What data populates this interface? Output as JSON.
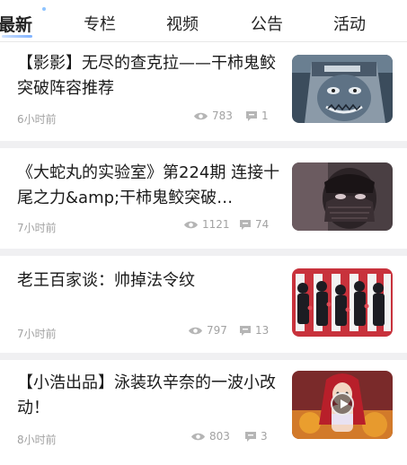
{
  "tabs": [
    {
      "label": "最新",
      "active": true
    },
    {
      "label": "专栏",
      "active": false
    },
    {
      "label": "视频",
      "active": false
    },
    {
      "label": "公告",
      "active": false
    },
    {
      "label": "活动",
      "active": false
    }
  ],
  "articles": [
    {
      "title": "【影影】无尽的查克拉——干柿鬼鲛突破阵容推荐",
      "time": "6小时前",
      "views": "783",
      "comments": "1",
      "thumb_icon": "masked-ninja-thumbnail",
      "has_video": false
    },
    {
      "title": "《大蛇丸的实验室》第224期 连接十尾之力&amp;干柿鬼鲛突破…",
      "time": "7小时前",
      "views": "1121",
      "comments": "74",
      "thumb_icon": "masked-ninja-thumbnail",
      "has_video": false
    },
    {
      "title": "老王百家谈：帅掉法令纹",
      "time": "7小时前",
      "views": "797",
      "comments": "13",
      "thumb_icon": "character-lineup-thumbnail",
      "has_video": false
    },
    {
      "title": "【小浩出品】泳装玖辛奈的一波小改动！",
      "time": "8小时前",
      "views": "803",
      "comments": "3",
      "thumb_icon": "red-hair-character-thumbnail",
      "has_video": true
    }
  ],
  "icons": {
    "views": "eye-icon",
    "comments": "comment-bubble-icon",
    "play": "play-icon"
  },
  "colors": {
    "title": "#1a1a1a",
    "meta": "#a2a2a2",
    "tab_accent": "#7fb2ff",
    "separator": "#f0f0f2"
  }
}
